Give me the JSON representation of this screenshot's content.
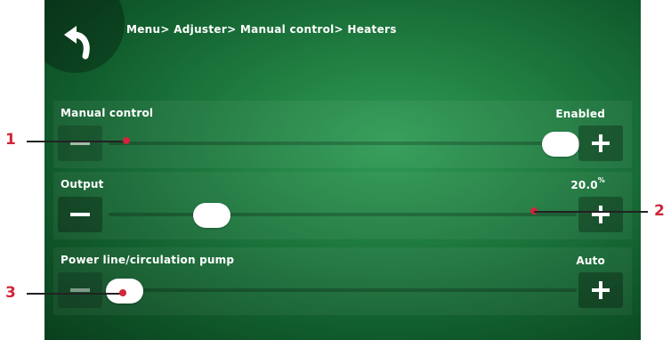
{
  "breadcrumb": "Menu> Adjuster> Manual control> Heaters",
  "icons": {
    "back": "back-arrow-icon",
    "minus": "minus-icon",
    "plus": "plus-icon"
  },
  "colors": {
    "background": "#1f7c40",
    "callout": "#d0253a"
  },
  "rows": [
    {
      "label": "Manual control",
      "value": "Enabled",
      "unit": "",
      "level": 1.0
    },
    {
      "label": "Output",
      "value": "20.0",
      "unit": "%",
      "level": 0.2
    },
    {
      "label": "Power line/circulation pump",
      "value": "Auto",
      "unit": "",
      "level": 0.0
    }
  ],
  "callouts": [
    "1",
    "2",
    "3"
  ]
}
